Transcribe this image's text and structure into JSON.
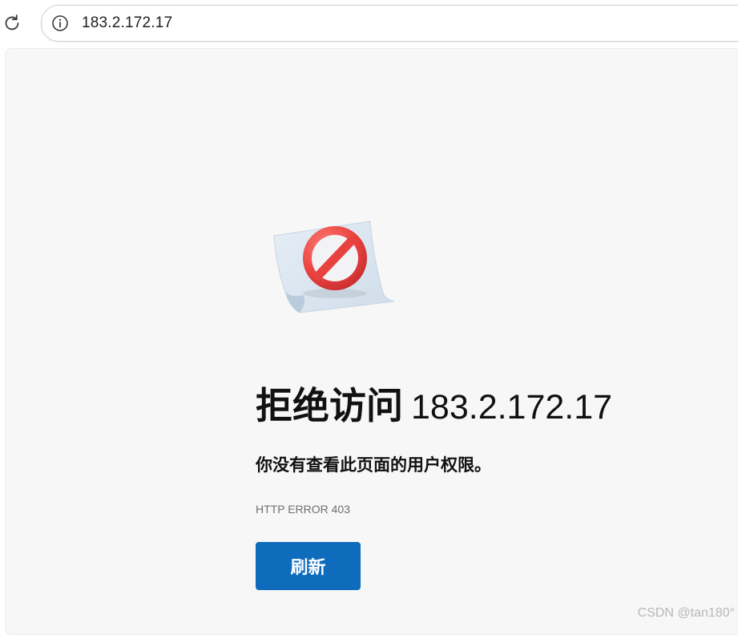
{
  "browser": {
    "address": "183.2.172.17",
    "reload_icon": "reload-icon",
    "info_icon": "info-icon"
  },
  "error": {
    "icon": "blocked-icon",
    "title": "拒绝访问",
    "host": "183.2.172.17",
    "message": "你没有查看此页面的用户权限。",
    "code": "HTTP ERROR 403",
    "refresh_label": "刷新"
  },
  "colors": {
    "accent": "#0f6cbd",
    "blocked_red": "#e8423f",
    "page_background": "#f7f7f7"
  },
  "watermark": "CSDN @tan180°"
}
